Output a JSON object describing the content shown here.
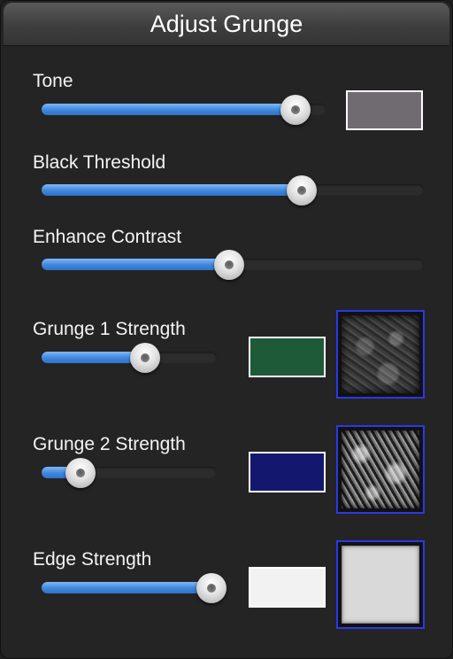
{
  "panel": {
    "title": "Adjust Grunge"
  },
  "controls": {
    "tone": {
      "label": "Tone",
      "value": 0.89,
      "swatch_color": "#6f6b70"
    },
    "black_threshold": {
      "label": "Black Threshold",
      "value": 0.68
    },
    "enhance_contrast": {
      "label": "Enhance Contrast",
      "value": 0.49
    },
    "grunge1": {
      "label": "Grunge 1 Strength",
      "value": 0.59,
      "swatch_color": "#1e5a38",
      "texture_icon": "grunge-texture-1"
    },
    "grunge2": {
      "label": "Grunge 2 Strength",
      "value": 0.22,
      "swatch_color": "#13186e",
      "texture_icon": "grunge-texture-2"
    },
    "edge": {
      "label": "Edge Strength",
      "value": 0.97,
      "swatch_color": "#f2f2f2",
      "texture_icon": "edge-texture"
    }
  },
  "colors": {
    "accent_fill": "#3f86dc",
    "thumb_border": "#2b39e6"
  }
}
